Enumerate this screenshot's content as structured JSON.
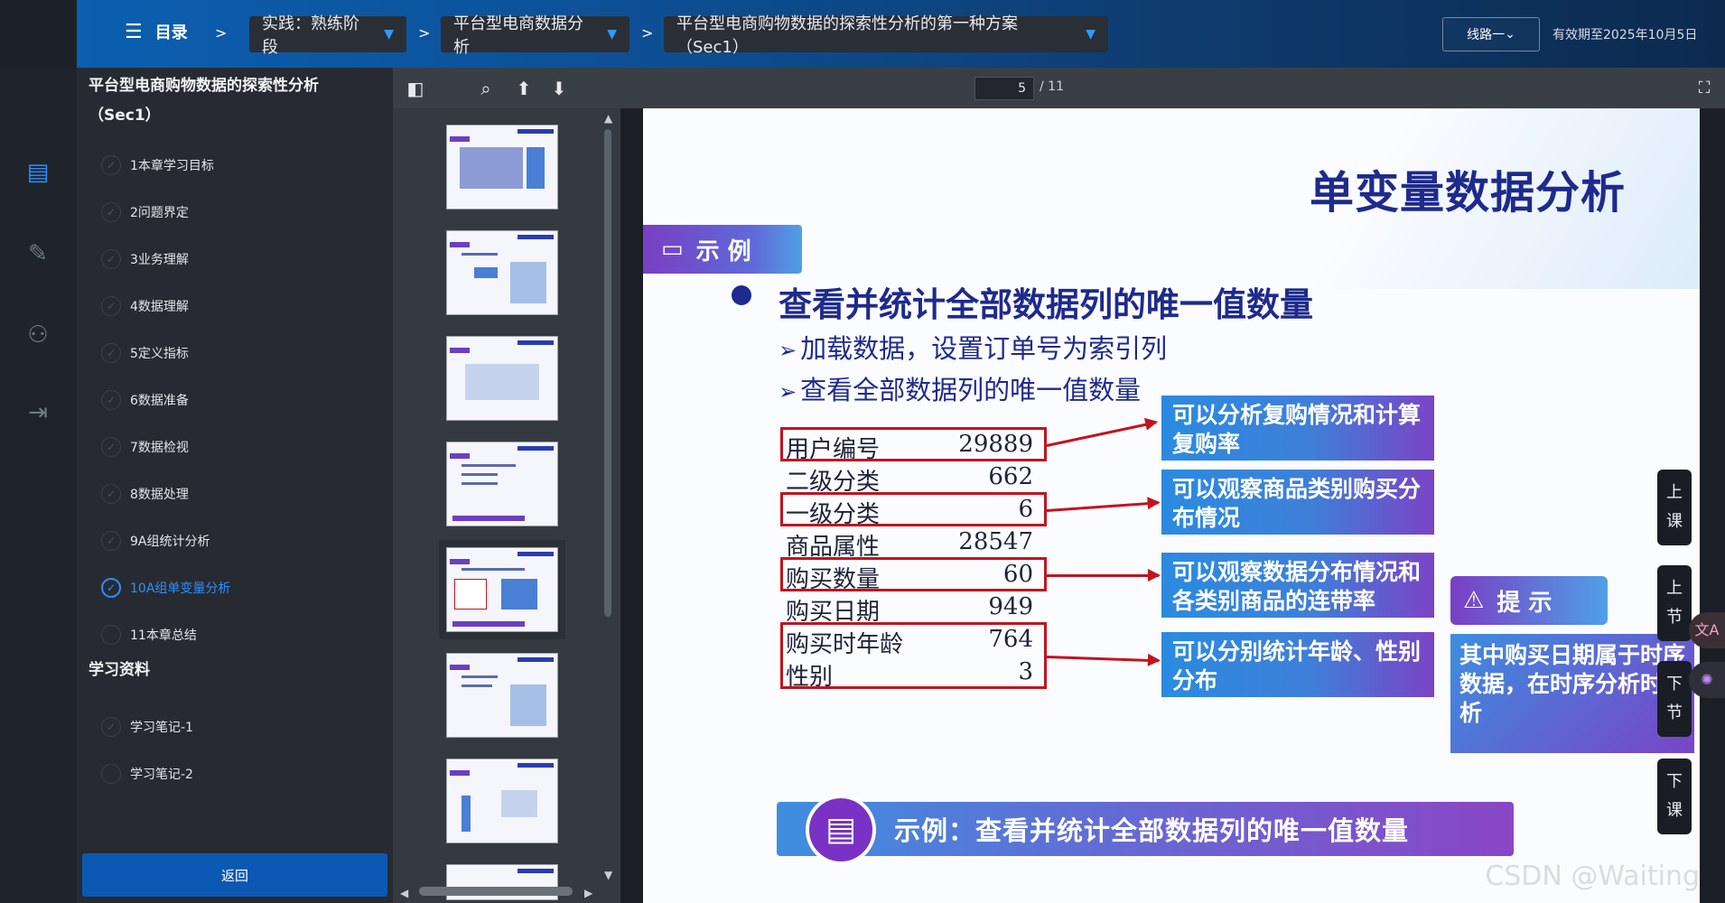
{
  "header": {
    "menu_label": "目录",
    "breadcrumbs": [
      {
        "label": "实践：熟练阶段"
      },
      {
        "label": "平台型电商数据分析"
      },
      {
        "label": "平台型电商购物数据的探索性分析的第一种方案（Sec1）"
      }
    ],
    "route_label": "线路一",
    "expiry": "有效期至2025年10月5日"
  },
  "sidebar": {
    "title": "平台型电商购物数据的探索性分析（Sec1）",
    "chapters": [
      {
        "label": "1本章学习目标",
        "active": false
      },
      {
        "label": "2问题界定",
        "active": false
      },
      {
        "label": "3业务理解",
        "active": false
      },
      {
        "label": "4数据理解",
        "active": false
      },
      {
        "label": "5定义指标",
        "active": false
      },
      {
        "label": "6数据准备",
        "active": false
      },
      {
        "label": "7数据检视",
        "active": false
      },
      {
        "label": "8数据处理",
        "active": false
      },
      {
        "label": "9A组统计分析",
        "active": false
      },
      {
        "label": "10A组单变量分析",
        "active": true
      },
      {
        "label": "11本章总结",
        "active": false
      }
    ],
    "materials_title": "学习资料",
    "materials": [
      {
        "label": "学习笔记-1"
      },
      {
        "label": "学习笔记-2"
      }
    ],
    "back_label": "返回"
  },
  "pdf": {
    "current_page": "5",
    "total_pages": "/ 11"
  },
  "slide": {
    "title": "单变量数据分析",
    "example_tag": "示 例",
    "main_point": "查看并统计全部数据列的唯一值数量",
    "sub_points": [
      "加载数据，设置订单号为索引列",
      "查看全部数据列的唯一值数量"
    ],
    "stats": [
      {
        "name": "用户编号",
        "value": "29889"
      },
      {
        "name": "二级分类",
        "value": "662"
      },
      {
        "name": "一级分类",
        "value": "6"
      },
      {
        "name": "商品属性",
        "value": "28547"
      },
      {
        "name": "购买数量",
        "value": "60"
      },
      {
        "name": "购买日期",
        "value": "949"
      },
      {
        "name": "购买时年龄",
        "value": "764"
      },
      {
        "name": "性别",
        "value": "3"
      }
    ],
    "callouts": [
      "可以分析复购情况和计算复购率",
      "可以观察商品类别购买分布情况",
      "可以观察数据分布情况和各类别商品的连带率",
      "可以分别统计年龄、性别分布"
    ],
    "tip_tag": "提 示",
    "tip_text": "其中购买日期属于时序数据，在时序分析时分析",
    "bottom_bar": "示例：查看并统计全部数据列的唯一值数量"
  },
  "float_nav": [
    {
      "label": "上课"
    },
    {
      "label": "上节"
    },
    {
      "label": "下节"
    },
    {
      "label": "下课"
    }
  ],
  "watermark": "CSDN @Waiting",
  "colors": {
    "accent": "#2e8fff",
    "header_blue": "#0b5fb0",
    "slide_navy": "#1e2a8c",
    "highlight_red": "#c2141e"
  }
}
